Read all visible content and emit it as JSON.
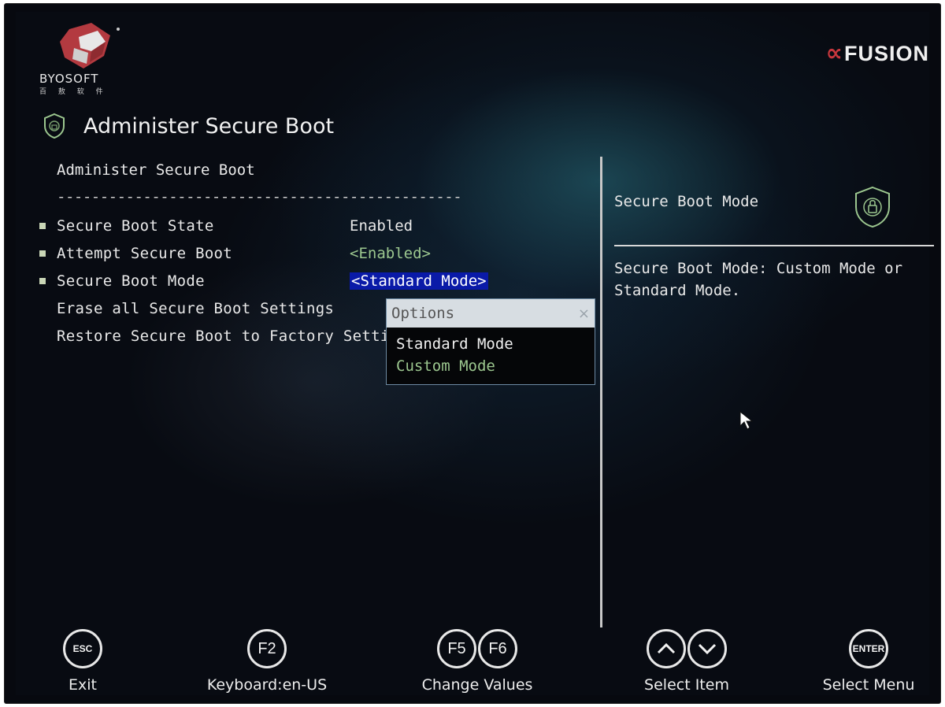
{
  "brand": {
    "name": "BYOSOFT",
    "sub": "百 敖 软 件",
    "vendor_mark": "∝",
    "vendor_text": "FUSION"
  },
  "page_title": "Administer Secure Boot",
  "menu": {
    "heading": "Administer Secure Boot",
    "separator": "-----------------------------------------------",
    "items": [
      {
        "label": "Secure Boot State",
        "value": "Enabled"
      },
      {
        "label": "Attempt Secure Boot",
        "value": "<Enabled>"
      },
      {
        "label": "Secure Boot Mode",
        "value": "<Standard Mode>"
      },
      {
        "label": "Erase all Secure Boot Settings"
      },
      {
        "label": "Restore Secure Boot to Factory Settir"
      }
    ]
  },
  "options": {
    "title": "Options",
    "close": "×",
    "items": [
      "Standard Mode",
      "Custom Mode"
    ]
  },
  "help": {
    "title": "Secure Boot Mode",
    "text": "Secure Boot Mode: Custom Mode or Standard Mode."
  },
  "footer": [
    {
      "keys": [
        "ESC"
      ],
      "label": "Exit"
    },
    {
      "keys": [
        "F2"
      ],
      "label": "Keyboard:en-US"
    },
    {
      "keys": [
        "F5",
        "F6"
      ],
      "label": "Change Values"
    },
    {
      "keys": [
        "up-arrow",
        "down-arrow"
      ],
      "label": "Select Item"
    },
    {
      "keys": [
        "ENTER"
      ],
      "label": "Select Menu"
    }
  ],
  "colors": {
    "selection": "#0a1aa8",
    "green_value": "#9cc78f",
    "brand_red": "#c8373d"
  }
}
